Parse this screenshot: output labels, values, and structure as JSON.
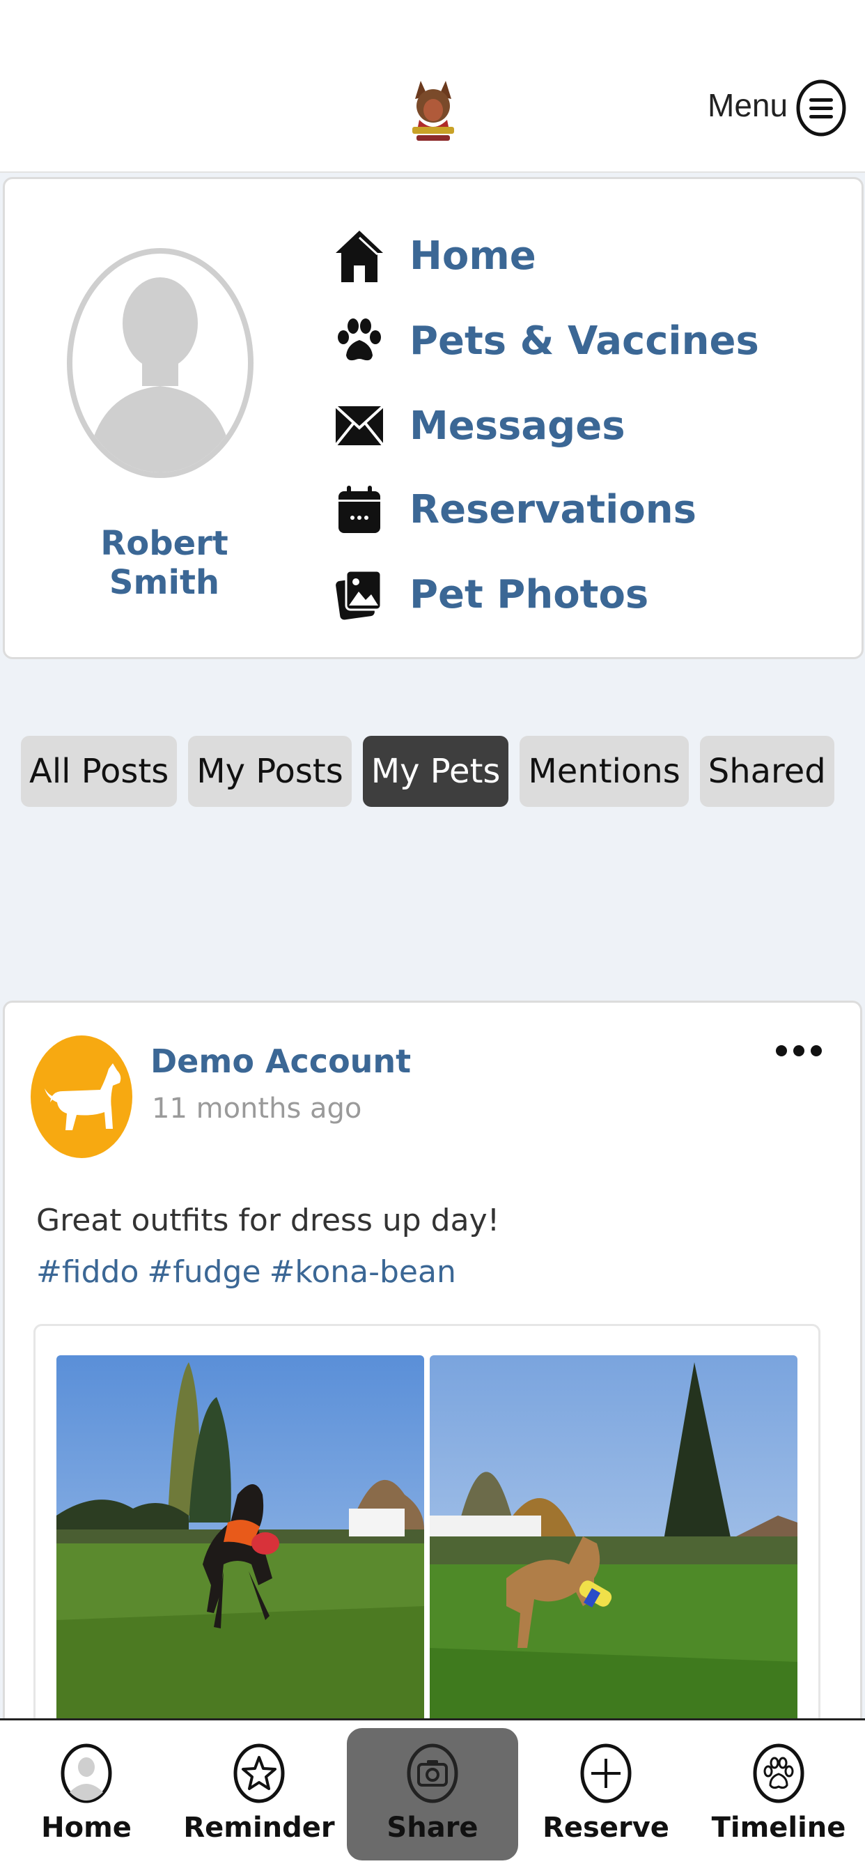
{
  "header": {
    "logo_name": "salon-logo",
    "menu_label": "Menu"
  },
  "profile": {
    "name": "Robert Smith"
  },
  "nav": {
    "items": [
      {
        "label": "Home",
        "icon": "house-icon"
      },
      {
        "label": "Pets & Vaccines",
        "icon": "paw-icon"
      },
      {
        "label": "Messages",
        "icon": "envelope-icon"
      },
      {
        "label": "Reservations",
        "icon": "calendar-icon"
      },
      {
        "label": "Pet Photos",
        "icon": "photos-icon"
      }
    ]
  },
  "filters": {
    "chips": [
      "All Posts",
      "My Posts",
      "My Pets",
      "Mentions",
      "Shared"
    ],
    "active": "My Pets"
  },
  "post": {
    "author": "Demo Account",
    "time": "11 months ago",
    "text": "Great outfits for dress up day!",
    "tags": [
      "#fiddo",
      "#fudge",
      "#kona-bean"
    ]
  },
  "bottom_nav": {
    "tabs": [
      {
        "label": "Home",
        "icon": "user-circle-icon"
      },
      {
        "label": "Reminder",
        "icon": "star-icon"
      },
      {
        "label": "Share",
        "icon": "camera-icon"
      },
      {
        "label": "Reserve",
        "icon": "plus-circle-icon"
      },
      {
        "label": "Timeline",
        "icon": "paw-circle-icon"
      }
    ],
    "active": "Share"
  },
  "colors": {
    "link_blue": "#3b6795",
    "chip_active": "#3e3e3e",
    "chip_inactive": "#dcdcdc",
    "avatar_orange": "#f7a911",
    "page_bg": "#eef2f7"
  }
}
